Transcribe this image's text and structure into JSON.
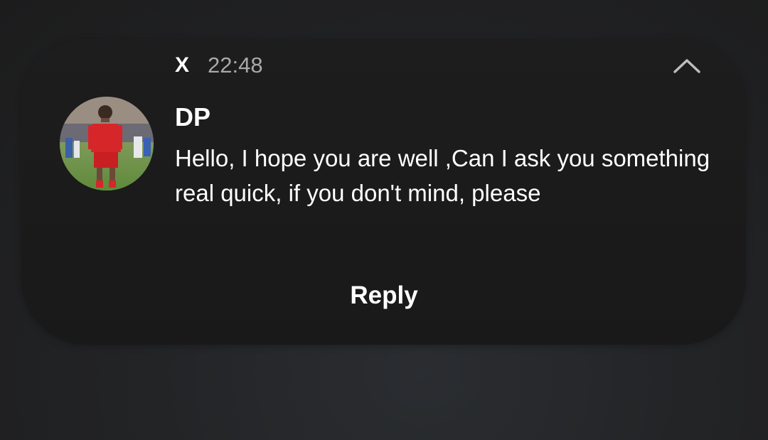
{
  "notification": {
    "app_name": "X",
    "time": "22:48",
    "collapse_icon": "chevron-up-icon",
    "avatar_icon": "profile-photo-avatar",
    "sender": "DP",
    "message": "Hello, I hope you are well ,Can I ask you something real quick, if you don't mind, please",
    "reply_label": "Reply"
  },
  "colors": {
    "card_background": "#1b1b1b",
    "page_background": "#232426",
    "primary_text": "#ffffff",
    "secondary_text": "#a9a9a9"
  }
}
